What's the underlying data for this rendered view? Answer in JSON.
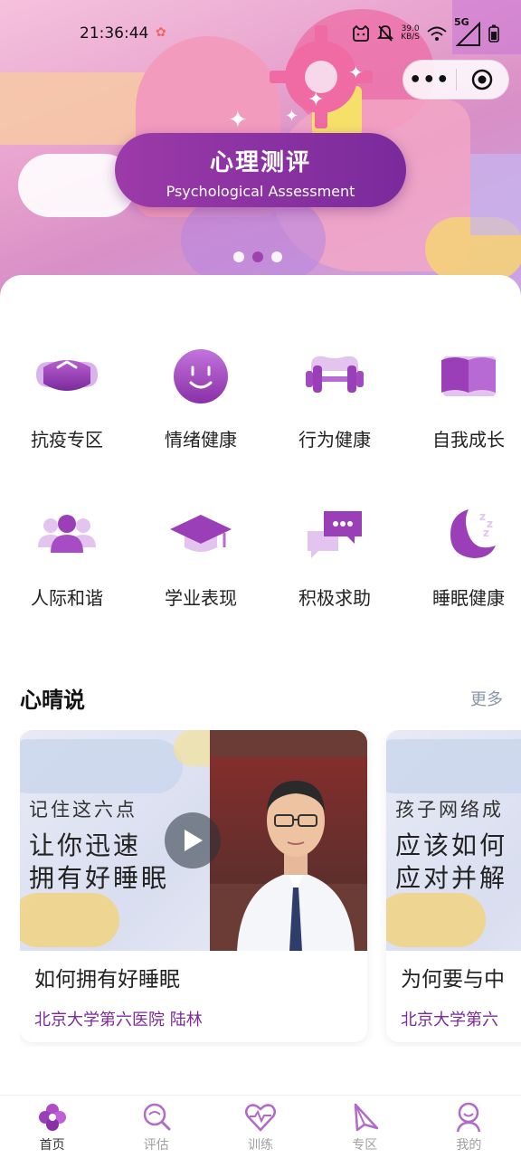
{
  "status_bar": {
    "time": "21:36:44",
    "net_speed_value": "39.0",
    "net_speed_unit": "KB/S",
    "network": "5G"
  },
  "banner": {
    "title": "心理测评",
    "subtitle": "Psychological Assessment",
    "page_count": 3,
    "active_index": 1
  },
  "capsule": {
    "more_label": "•••"
  },
  "categories": [
    {
      "label": "抗疫专区",
      "icon": "mask-icon"
    },
    {
      "label": "情绪健康",
      "icon": "smile-icon"
    },
    {
      "label": "行为健康",
      "icon": "dumbbell-icon"
    },
    {
      "label": "自我成长",
      "icon": "book-icon"
    },
    {
      "label": "人际和谐",
      "icon": "people-icon"
    },
    {
      "label": "学业表现",
      "icon": "graduation-cap-icon"
    },
    {
      "label": "积极求助",
      "icon": "chat-bubbles-icon"
    },
    {
      "label": "睡眠健康",
      "icon": "moon-sleep-icon"
    }
  ],
  "section": {
    "title": "心晴说",
    "more": "更多"
  },
  "cards": [
    {
      "image_small": "记住这六点",
      "image_line1": "让你迅速",
      "image_line2": "拥有好睡眠",
      "title": "如何拥有好睡眠",
      "subtitle": "北京大学第六医院 陆林"
    },
    {
      "image_small": "孩子网络成",
      "image_line1": "应该如何",
      "image_line2": "应对并解",
      "title": "为何要与中",
      "subtitle": "北京大学第六"
    }
  ],
  "bottom_nav": [
    {
      "label": "首页",
      "icon": "home-flower-icon",
      "active": true
    },
    {
      "label": "评估",
      "icon": "magnifier-icon",
      "active": false
    },
    {
      "label": "训练",
      "icon": "heartbeat-icon",
      "active": false
    },
    {
      "label": "专区",
      "icon": "paper-plane-icon",
      "active": false
    },
    {
      "label": "我的",
      "icon": "user-icon",
      "active": false
    }
  ],
  "colors": {
    "primary": "#9b3aa8",
    "accent_deep": "#7a2a9c",
    "nav_inactive": "#a0a0a0",
    "more_gray": "#8a96a6"
  }
}
